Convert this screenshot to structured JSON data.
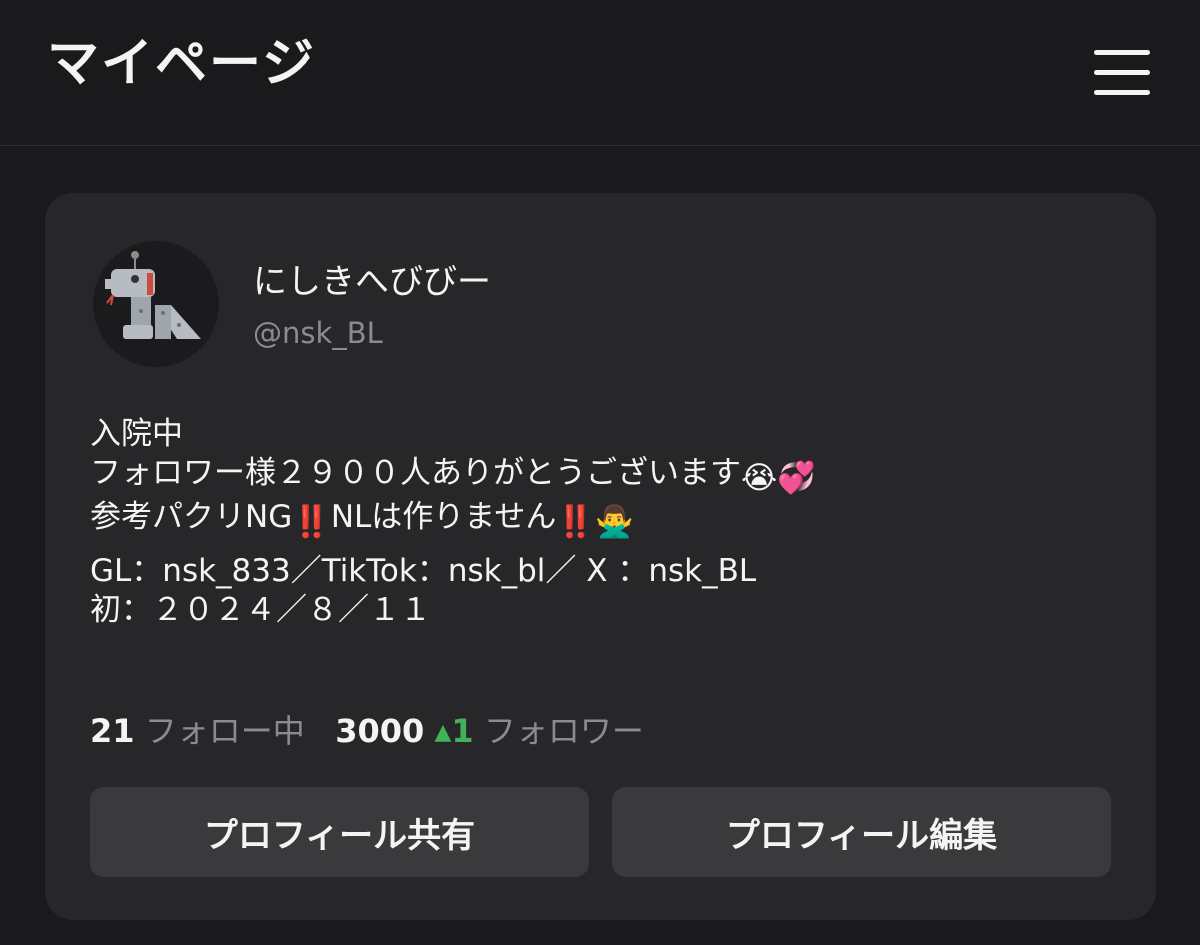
{
  "header": {
    "title": "マイページ",
    "menu_icon": "hamburger-menu-icon"
  },
  "profile": {
    "display_name": "にしきへびびー",
    "handle": "@nsk_BL",
    "avatar_icon": "robot-snake-avatar",
    "bio": {
      "line1": "入院中",
      "line2": "フォロワー様２９００人ありがとうございます",
      "line2_emojis": [
        "😭",
        "💞"
      ],
      "line3_a": "参考パクリNG",
      "line3_b": "NLは作りません",
      "line3_emojis": [
        "‼️",
        "‼️",
        "🙅‍♂️"
      ],
      "line4": "GL：nsk_833／TikTok：nsk_bl／ X ：nsk_BL",
      "line5": "初：２０２４／８／１１"
    }
  },
  "stats": {
    "following_count": "21",
    "following_label": "フォロー中",
    "followers_count": "3000",
    "followers_delta": "1",
    "followers_label": "フォロワー",
    "delta_color": "#3fb25a"
  },
  "actions": {
    "share_label": "プロフィール共有",
    "edit_label": "プロフィール編集"
  }
}
